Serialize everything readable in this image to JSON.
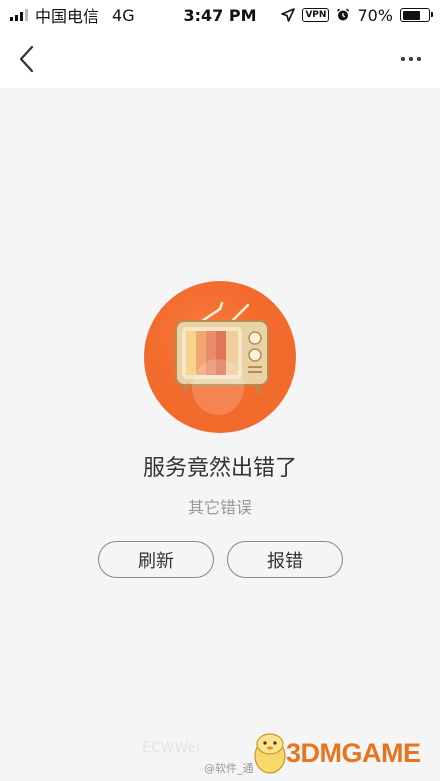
{
  "status_bar": {
    "carrier": "中国电信",
    "network": "4G",
    "time": "3:47 PM",
    "vpn": "VPN",
    "battery": "70%",
    "battery_level": 0.7
  },
  "nav": {
    "back_icon": "chevron-left-icon",
    "more_icon": "more-dots-icon"
  },
  "error": {
    "title": "服务竟然出错了",
    "subtitle": "其它错误",
    "illustration_icon": "retro-tv-icon"
  },
  "actions": {
    "refresh_label": "刷新",
    "report_label": "报错"
  },
  "watermark": {
    "faint_text": "ECWWei",
    "weibo": "@软件_通",
    "logo": "3DMGAME"
  },
  "colors": {
    "accent_orange": "#f26b2c",
    "tv_body": "#e8d3a8",
    "logo_orange": "#e7751f",
    "background": "#f5f5f5"
  }
}
